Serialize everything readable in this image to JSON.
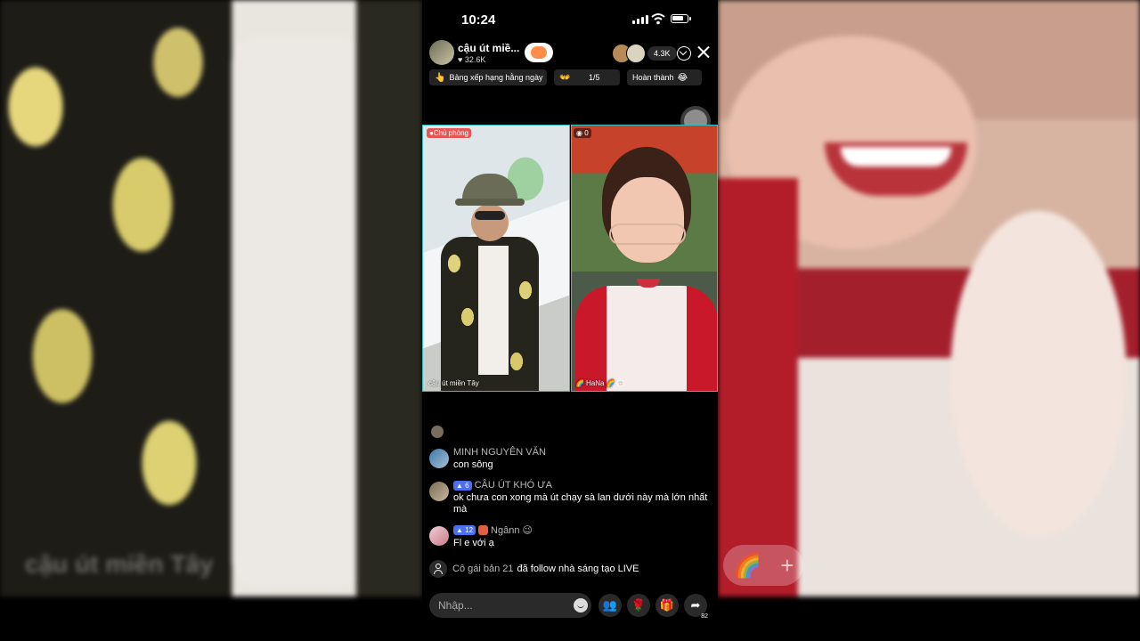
{
  "status_bar": {
    "time": "10:24"
  },
  "header": {
    "host_name": "cậu út miề...",
    "host_likes": "♥ 32.6K",
    "viewer_count": "4.3K"
  },
  "pills": {
    "rank": "Bảng xếp hạng hằng ngày",
    "task_progress": "1/5",
    "done": "Hoàn thành"
  },
  "video": {
    "left_badge": "Chủ phòng",
    "left_name": "cậu út miền Tây",
    "right_score": "0",
    "right_name": "HaNa"
  },
  "background": {
    "watermark": "cậu út miền Tây"
  },
  "chat": {
    "messages": [
      {
        "user": "MINH NGUYÊN VĂN",
        "text": "con sông"
      },
      {
        "user": "CẬU ÚT KHÓ ƯA",
        "level": "6",
        "text": "ok chưa con xong mà út chạy sà lan dưới này mà lớn nhất mà"
      },
      {
        "user": "Ngânn",
        "level": "12",
        "emoji": "😉",
        "text": "Fl e với ạ"
      }
    ],
    "notice": {
      "user": "Cô gái bản 21",
      "text": "đã follow nhà sáng tạo LIVE"
    }
  },
  "bottom_bar": {
    "input_placeholder": "Nhập...",
    "share_count": "82"
  },
  "icons": {
    "guests": "guests-icon",
    "rose": "rose-icon",
    "gift": "gift-icon",
    "share": "share-icon"
  }
}
